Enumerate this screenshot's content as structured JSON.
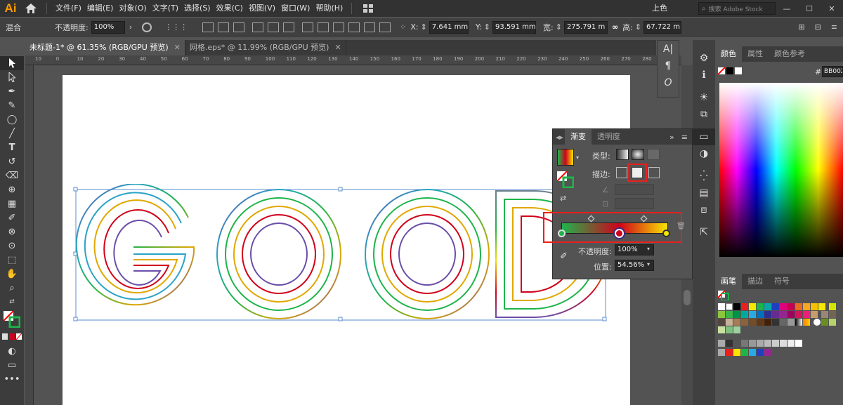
{
  "menubar": {
    "logo": "Ai",
    "items": [
      "文件(F)",
      "编辑(E)",
      "对象(O)",
      "文字(T)",
      "选择(S)",
      "效果(C)",
      "视图(V)",
      "窗口(W)",
      "帮助(H)"
    ],
    "workspace": "上色",
    "search_placeholder": "搜索 Adobe Stock"
  },
  "controlbar": {
    "blend_label": "混合",
    "opacity_label": "不透明度:",
    "opacity_value": "100%",
    "x_label": "X:",
    "x_value": "7.641 mm",
    "y_label": "Y:",
    "y_value": "93.591 mm",
    "w_label": "宽:",
    "w_value": "275.791 m",
    "h_label": "高:",
    "h_value": "67.722 m"
  },
  "tabs": [
    {
      "label": "未标题-1* @ 61.35% (RGB/GPU 预览)",
      "active": true
    },
    {
      "label": "网格.eps* @ 11.99% (RGB/GPU 预览)",
      "active": false
    }
  ],
  "ruler_ticks": [
    "10",
    "0",
    "10",
    "20",
    "30",
    "40",
    "50",
    "60",
    "70",
    "80",
    "90",
    "100",
    "110",
    "120",
    "130",
    "140",
    "150",
    "160",
    "170",
    "180",
    "190",
    "200",
    "210",
    "220",
    "230",
    "240",
    "250",
    "260",
    "270",
    "280"
  ],
  "artwork": {
    "letters": "GOOD"
  },
  "gradient_panel": {
    "tab_gradient": "渐变",
    "tab_transparency": "透明度",
    "type_label": "类型:",
    "stroke_label": "描边:",
    "opacity_label": "不透明度:",
    "opacity_value": "100%",
    "position_label": "位置:",
    "position_value": "54.56%",
    "stops": [
      {
        "color": "#1eb44a",
        "position": 0
      },
      {
        "color": "#d0021b",
        "position": 54.56
      },
      {
        "color": "#f7e700",
        "position": 100
      }
    ],
    "highlight_color": "#e8201f"
  },
  "color_panel": {
    "tabs": [
      "颜色",
      "属性",
      "颜色参考"
    ],
    "hex_label": "#",
    "hex_value": "BB002"
  },
  "swatch_panel": {
    "tabs": [
      "画笔",
      "描边",
      "符号"
    ]
  },
  "toolbar_glyphs": [
    "▲",
    "▷",
    "✎",
    "✒",
    "◯",
    "/",
    "T",
    "↺",
    "✂",
    "⊕",
    "▦",
    "✐",
    "✋",
    "⊗",
    "⬚",
    "🔍"
  ]
}
